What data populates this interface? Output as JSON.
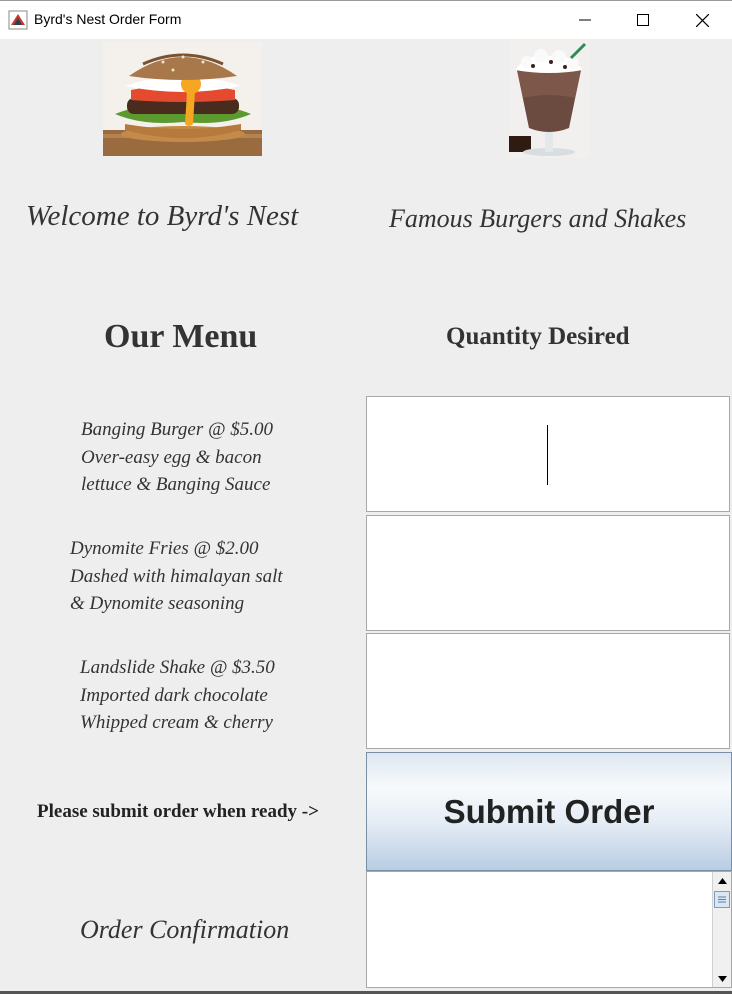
{
  "window": {
    "title": "Byrd's Nest Order Form",
    "controls": [
      "minimize-icon",
      "maximize-icon",
      "close-icon"
    ]
  },
  "header": {
    "welcome": "Welcome to Byrd's Nest",
    "tagline": "Famous Burgers and Shakes"
  },
  "images": {
    "left": "burger-image",
    "right": "shake-image"
  },
  "menu": {
    "heading": "Our Menu",
    "qty_heading": "Quantity Desired",
    "items": [
      {
        "line1": "Banging Burger @ $5.00",
        "line2": "Over-easy egg & bacon",
        "line3": "lettuce & Banging Sauce",
        "qty": ""
      },
      {
        "line1": "Dynomite Fries @ $2.00",
        "line2": "Dashed with himalayan salt",
        "line3": "& Dynomite seasoning",
        "qty": ""
      },
      {
        "line1": "Landslide Shake @ $3.50",
        "line2": "Imported dark chocolate",
        "line3": "Whipped cream & cherry",
        "qty": ""
      }
    ]
  },
  "submit": {
    "prompt": "Please submit order when ready ->",
    "button": "Submit Order"
  },
  "confirmation": {
    "label": "Order Confirmation",
    "text": ""
  }
}
